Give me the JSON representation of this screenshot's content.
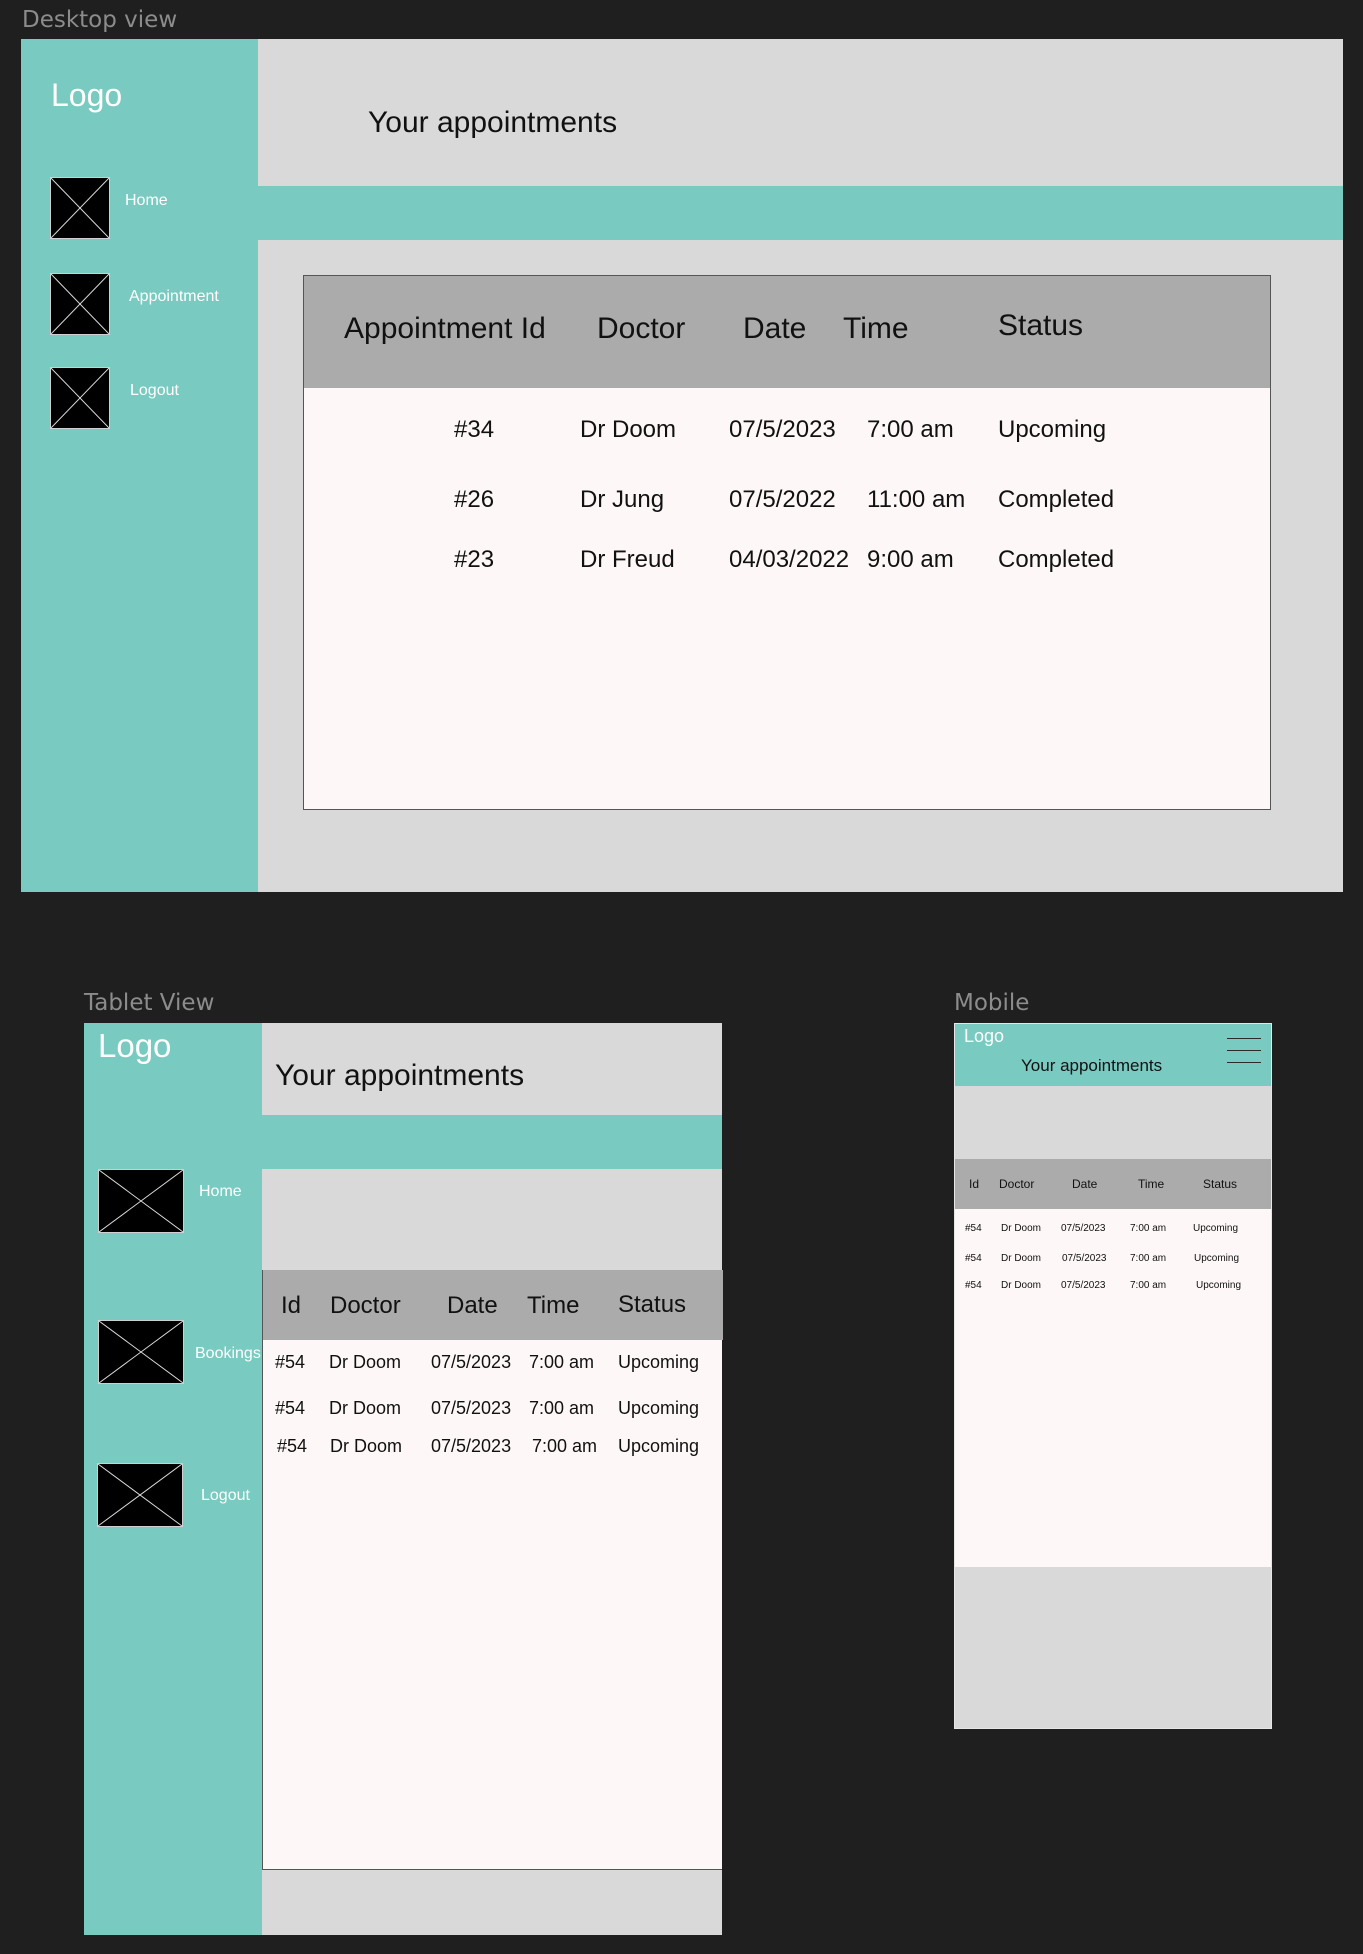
{
  "frames": {
    "desktop_label": "Desktop view",
    "tablet_label": "Tablet View",
    "mobile_label": "Mobile"
  },
  "colors": {
    "canvas": "#1f1f1f",
    "teal": "#79cac0",
    "gray": "#d9d9d9",
    "panel": "#fdf8f7",
    "table_header": "#ababab"
  },
  "desktop": {
    "logo": "Logo",
    "page_title": "Your appointments",
    "nav": [
      {
        "label": "Home",
        "icon": "placeholder-image-icon"
      },
      {
        "label": "Appointment",
        "icon": "placeholder-image-icon"
      },
      {
        "label": "Logout",
        "icon": "placeholder-image-icon"
      }
    ],
    "columns": [
      "Appointment Id",
      "Doctor",
      "Date",
      "Time",
      "Status"
    ],
    "rows": [
      [
        "#34",
        "Dr Doom",
        "07/5/2023",
        "7:00 am",
        "Upcoming"
      ],
      [
        "#26",
        "Dr Jung",
        "07/5/2022",
        "11:00 am",
        "Completed"
      ],
      [
        "#23",
        "Dr Freud",
        "04/03/2022",
        "9:00 am",
        "Completed"
      ]
    ]
  },
  "tablet": {
    "logo": "Logo",
    "page_title": "Your appointments",
    "nav": [
      {
        "label": "Home",
        "icon": "placeholder-image-icon"
      },
      {
        "label": "Bookings",
        "icon": "placeholder-image-icon"
      },
      {
        "label": "Logout",
        "icon": "placeholder-image-icon"
      }
    ],
    "columns": [
      "Id",
      "Doctor",
      "Date",
      "Time",
      "Status"
    ],
    "rows": [
      [
        "#54",
        "Dr Doom",
        "07/5/2023",
        "7:00 am",
        "Upcoming"
      ],
      [
        "#54",
        "Dr Doom",
        "07/5/2023",
        "7:00 am",
        "Upcoming"
      ],
      [
        "#54",
        "Dr Doom",
        "07/5/2023",
        "7:00 am",
        "Upcoming"
      ]
    ]
  },
  "mobile": {
    "logo": "Logo",
    "page_title": "Your appointments",
    "menu_icon": "hamburger-menu-icon",
    "columns": [
      "Id",
      "Doctor",
      "Date",
      "Time",
      "Status"
    ],
    "rows": [
      [
        "#54",
        "Dr Doom",
        "07/5/2023",
        "7:00 am",
        "Upcoming"
      ],
      [
        "#54",
        "Dr Doom",
        "07/5/2023",
        "7:00 am",
        "Upcoming"
      ],
      [
        "#54",
        "Dr Doom",
        "07/5/2023",
        "7:00 am",
        "Upcoming"
      ]
    ]
  }
}
